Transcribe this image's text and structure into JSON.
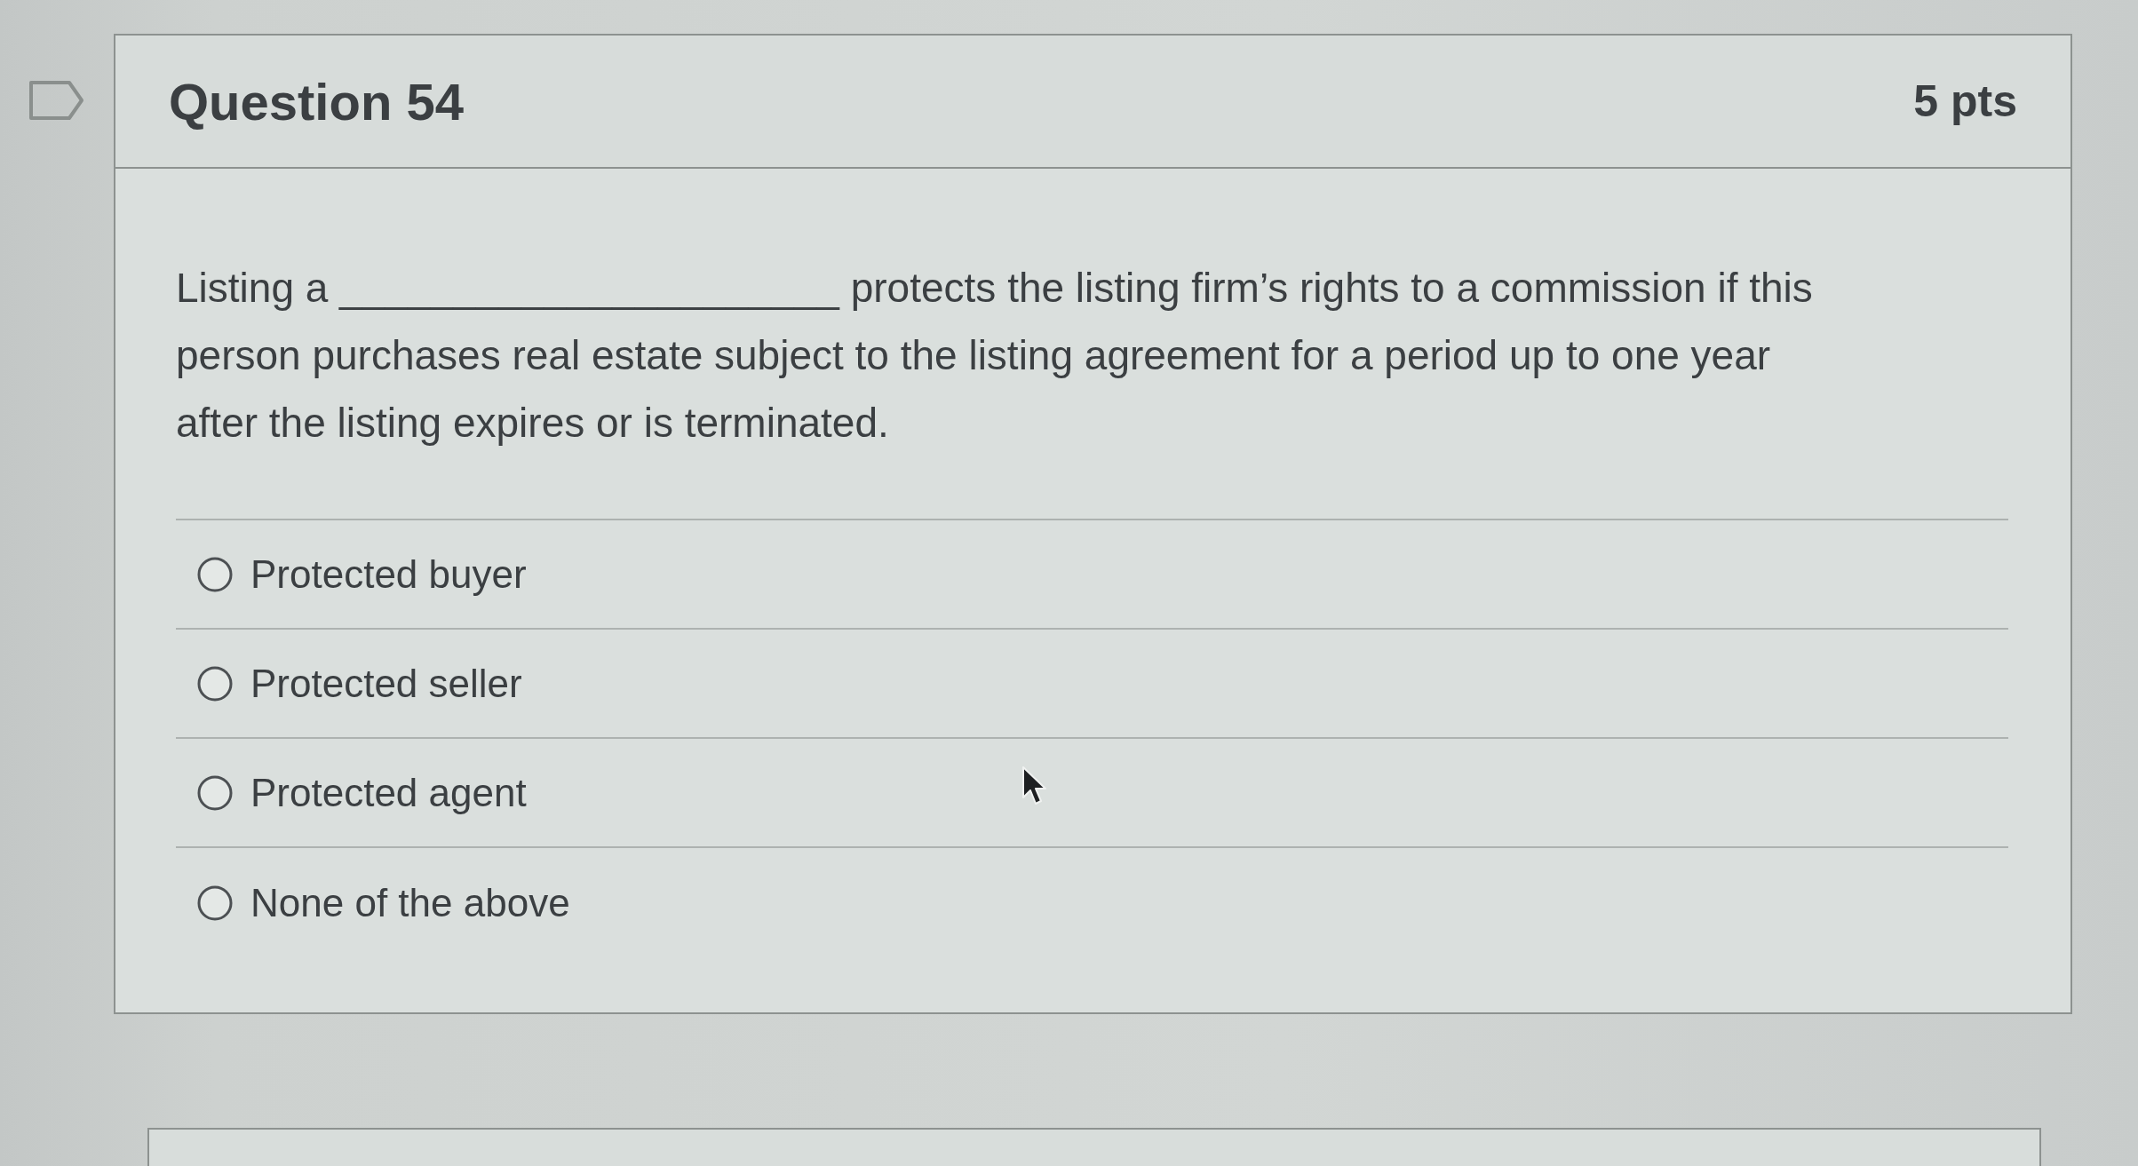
{
  "question": {
    "title": "Question 54",
    "points": "5 pts",
    "text": "Listing a ______________________ protects the listing firm’s rights to a commission if this\nperson purchases real estate subject to the listing agreement for a period up to one year\nafter the listing expires or is terminated.",
    "answers": [
      {
        "label": "Protected buyer",
        "selected": false
      },
      {
        "label": "Protected seller",
        "selected": false
      },
      {
        "label": "Protected agent",
        "selected": false
      },
      {
        "label": "None of the above",
        "selected": false
      }
    ]
  }
}
